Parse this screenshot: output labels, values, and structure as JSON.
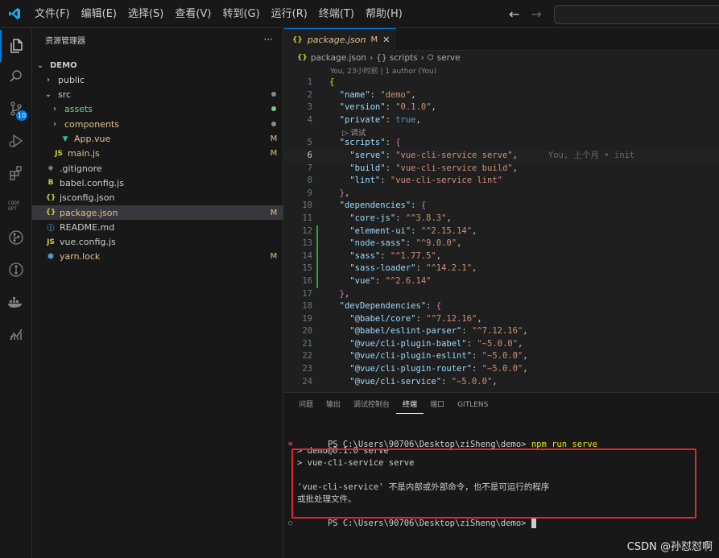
{
  "menu": [
    "文件(F)",
    "编辑(E)",
    "选择(S)",
    "查看(V)",
    "转到(G)",
    "运行(R)",
    "终端(T)",
    "帮助(H)"
  ],
  "activity": {
    "scm_badge": "10"
  },
  "sidebar": {
    "title": "资源管理器",
    "more": "···",
    "rows": [
      {
        "label": "DEMO",
        "chev": "⌄",
        "icon": "",
        "status": "",
        "color": "#cccccc",
        "indent": 4,
        "bold": true
      },
      {
        "label": "public",
        "chev": "›",
        "icon": "",
        "status": "",
        "color": "#cccccc",
        "indent": 14
      },
      {
        "label": "src",
        "chev": "⌄",
        "icon": "",
        "status": "dot",
        "color": "#cccccc",
        "indent": 14,
        "dot": "#8a8a8a"
      },
      {
        "label": "assets",
        "chev": "›",
        "icon": "",
        "status": "dot",
        "color": "#73c991",
        "indent": 22,
        "dot": "#73c991"
      },
      {
        "label": "components",
        "chev": "›",
        "icon": "",
        "status": "dot",
        "color": "#e2c08d",
        "indent": 22,
        "dot": "#8a8a8a"
      },
      {
        "label": "App.vue",
        "chev": "",
        "icon": "▼",
        "status": "M",
        "color": "#e2c08d",
        "indent": 22,
        "iconColor": "#41b883"
      },
      {
        "label": "main.js",
        "chev": "",
        "icon": "JS",
        "status": "M",
        "color": "#e2c08d",
        "indent": 14,
        "iconColor": "#cbcb41"
      },
      {
        "label": ".gitignore",
        "chev": "",
        "icon": "◆",
        "status": "",
        "color": "#cccccc",
        "indent": 4,
        "iconColor": "#6d8086"
      },
      {
        "label": "babel.config.js",
        "chev": "",
        "icon": "B",
        "status": "",
        "color": "#cccccc",
        "indent": 4,
        "iconColor": "#cbcb41"
      },
      {
        "label": "jsconfig.json",
        "chev": "",
        "icon": "{}",
        "status": "",
        "color": "#cccccc",
        "indent": 4,
        "iconColor": "#cbcb41"
      },
      {
        "label": "package.json",
        "chev": "",
        "icon": "{}",
        "status": "M",
        "color": "#e2c08d",
        "indent": 4,
        "iconColor": "#cbcb41",
        "selected": true
      },
      {
        "label": "README.md",
        "chev": "",
        "icon": "ⓘ",
        "status": "",
        "color": "#cccccc",
        "indent": 4,
        "iconColor": "#519aba"
      },
      {
        "label": "vue.config.js",
        "chev": "",
        "icon": "JS",
        "status": "",
        "color": "#cccccc",
        "indent": 4,
        "iconColor": "#cbcb41"
      },
      {
        "label": "yarn.lock",
        "chev": "",
        "icon": "⬢",
        "status": "M",
        "color": "#e2c08d",
        "indent": 4,
        "iconColor": "#519aba"
      }
    ]
  },
  "editor": {
    "tab_name": "package.json",
    "tab_status": "M",
    "tab_icon": "{}",
    "breadcrumb": [
      "package.json",
      "{} scripts",
      "serve"
    ],
    "breadcrumb_file_icon": "{}",
    "breadcrumb_serve_icon": "⬡",
    "blame": "You, 23小时前 | 1 author (You)",
    "codelens": "▷ 调试",
    "inline_blame": "You, 上个月 • init",
    "current_line": "6",
    "lines": [
      {
        "n": "1",
        "html": "<span class=\"p\">{</span>"
      },
      {
        "n": "2",
        "html": "  <span class=\"k\">\"name\"</span>: <span class=\"s\">\"demo\"</span>,"
      },
      {
        "n": "3",
        "html": "  <span class=\"k\">\"version\"</span>: <span class=\"s\">\"0.1.0\"</span>,"
      },
      {
        "n": "4",
        "html": "  <span class=\"k\">\"private\"</span>: <span class=\"b\">true</span>,"
      },
      {
        "n": "5",
        "html": "  <span class=\"k\">\"scripts\"</span>: <span class=\"p2\">{</span>"
      },
      {
        "n": "6",
        "html": "    <span class=\"k\">\"serve\"</span>: <span class=\"s\">\"vue-cli-service serve\"</span>,"
      },
      {
        "n": "7",
        "html": "    <span class=\"k\">\"build\"</span>: <span class=\"s\">\"vue-cli-service build\"</span>,"
      },
      {
        "n": "8",
        "html": "    <span class=\"k\">\"lint\"</span>: <span class=\"s\">\"vue-cli-service lint\"</span>"
      },
      {
        "n": "9",
        "html": "  <span class=\"p2\">}</span>,"
      },
      {
        "n": "10",
        "html": "  <span class=\"k\">\"dependencies\"</span>: <span class=\"p2\">{</span>"
      },
      {
        "n": "11",
        "html": "    <span class=\"k\">\"core-js\"</span>: <span class=\"s\">\"^3.8.3\"</span>,"
      },
      {
        "n": "12",
        "html": "    <span class=\"k\">\"element-ui\"</span>: <span class=\"s\">\"^2.15.14\"</span>,"
      },
      {
        "n": "13",
        "html": "    <span class=\"k\">\"node-sass\"</span>: <span class=\"s\">\"^9.0.0\"</span>,"
      },
      {
        "n": "14",
        "html": "    <span class=\"k\">\"sass\"</span>: <span class=\"s\">\"^1.77.5\"</span>,"
      },
      {
        "n": "15",
        "html": "    <span class=\"k\">\"sass-loader\"</span>: <span class=\"s\">\"^14.2.1\"</span>,"
      },
      {
        "n": "16",
        "html": "    <span class=\"k\">\"vue\"</span>: <span class=\"s\">\"^2.6.14\"</span>"
      },
      {
        "n": "17",
        "html": "  <span class=\"p2\">}</span>,"
      },
      {
        "n": "18",
        "html": "  <span class=\"k\">\"devDependencies\"</span>: <span class=\"p2\">{</span>"
      },
      {
        "n": "19",
        "html": "    <span class=\"k\">\"@babel/core\"</span>: <span class=\"s\">\"^7.12.16\"</span>,"
      },
      {
        "n": "20",
        "html": "    <span class=\"k\">\"@babel/eslint-parser\"</span>: <span class=\"s\">\"^7.12.16\"</span>,"
      },
      {
        "n": "21",
        "html": "    <span class=\"k\">\"@vue/cli-plugin-babel\"</span>: <span class=\"s\">\"~5.0.0\"</span>,"
      },
      {
        "n": "22",
        "html": "    <span class=\"k\">\"@vue/cli-plugin-eslint\"</span>: <span class=\"s\">\"~5.0.0\"</span>,"
      },
      {
        "n": "23",
        "html": "    <span class=\"k\">\"@vue/cli-plugin-router\"</span>: <span class=\"s\">\"~5.0.0\"</span>,"
      },
      {
        "n": "24",
        "html": "    <span class=\"k\">\"@vue/cli-service\"</span>: <span class=\"s\">\"~5.0.0\"</span>,"
      }
    ]
  },
  "panel": {
    "tabs": [
      "问题",
      "输出",
      "调试控制台",
      "终端",
      "端口",
      "GITLENS"
    ],
    "active_tab": "终端",
    "prompt": "PS C:\\Users\\90706\\Desktop\\ziSheng\\demo> ",
    "command": "npm run serve",
    "output": [
      "> demo@0.1.0 serve",
      "> vue-cli-service serve",
      "",
      "'vue-cli-service' 不是内部或外部命令，也不是可运行的程序",
      "或批处理文件。"
    ],
    "final_prompt": "PS C:\\Users\\90706\\Desktop\\ziSheng\\demo> "
  },
  "watermark": "CSDN @孙怼怼啊",
  "colors": {
    "accent": "#0078d4",
    "modified": "#e2c08d",
    "added": "#73c991",
    "error": "#f14c4c",
    "highlight_box": "#e5252d"
  }
}
